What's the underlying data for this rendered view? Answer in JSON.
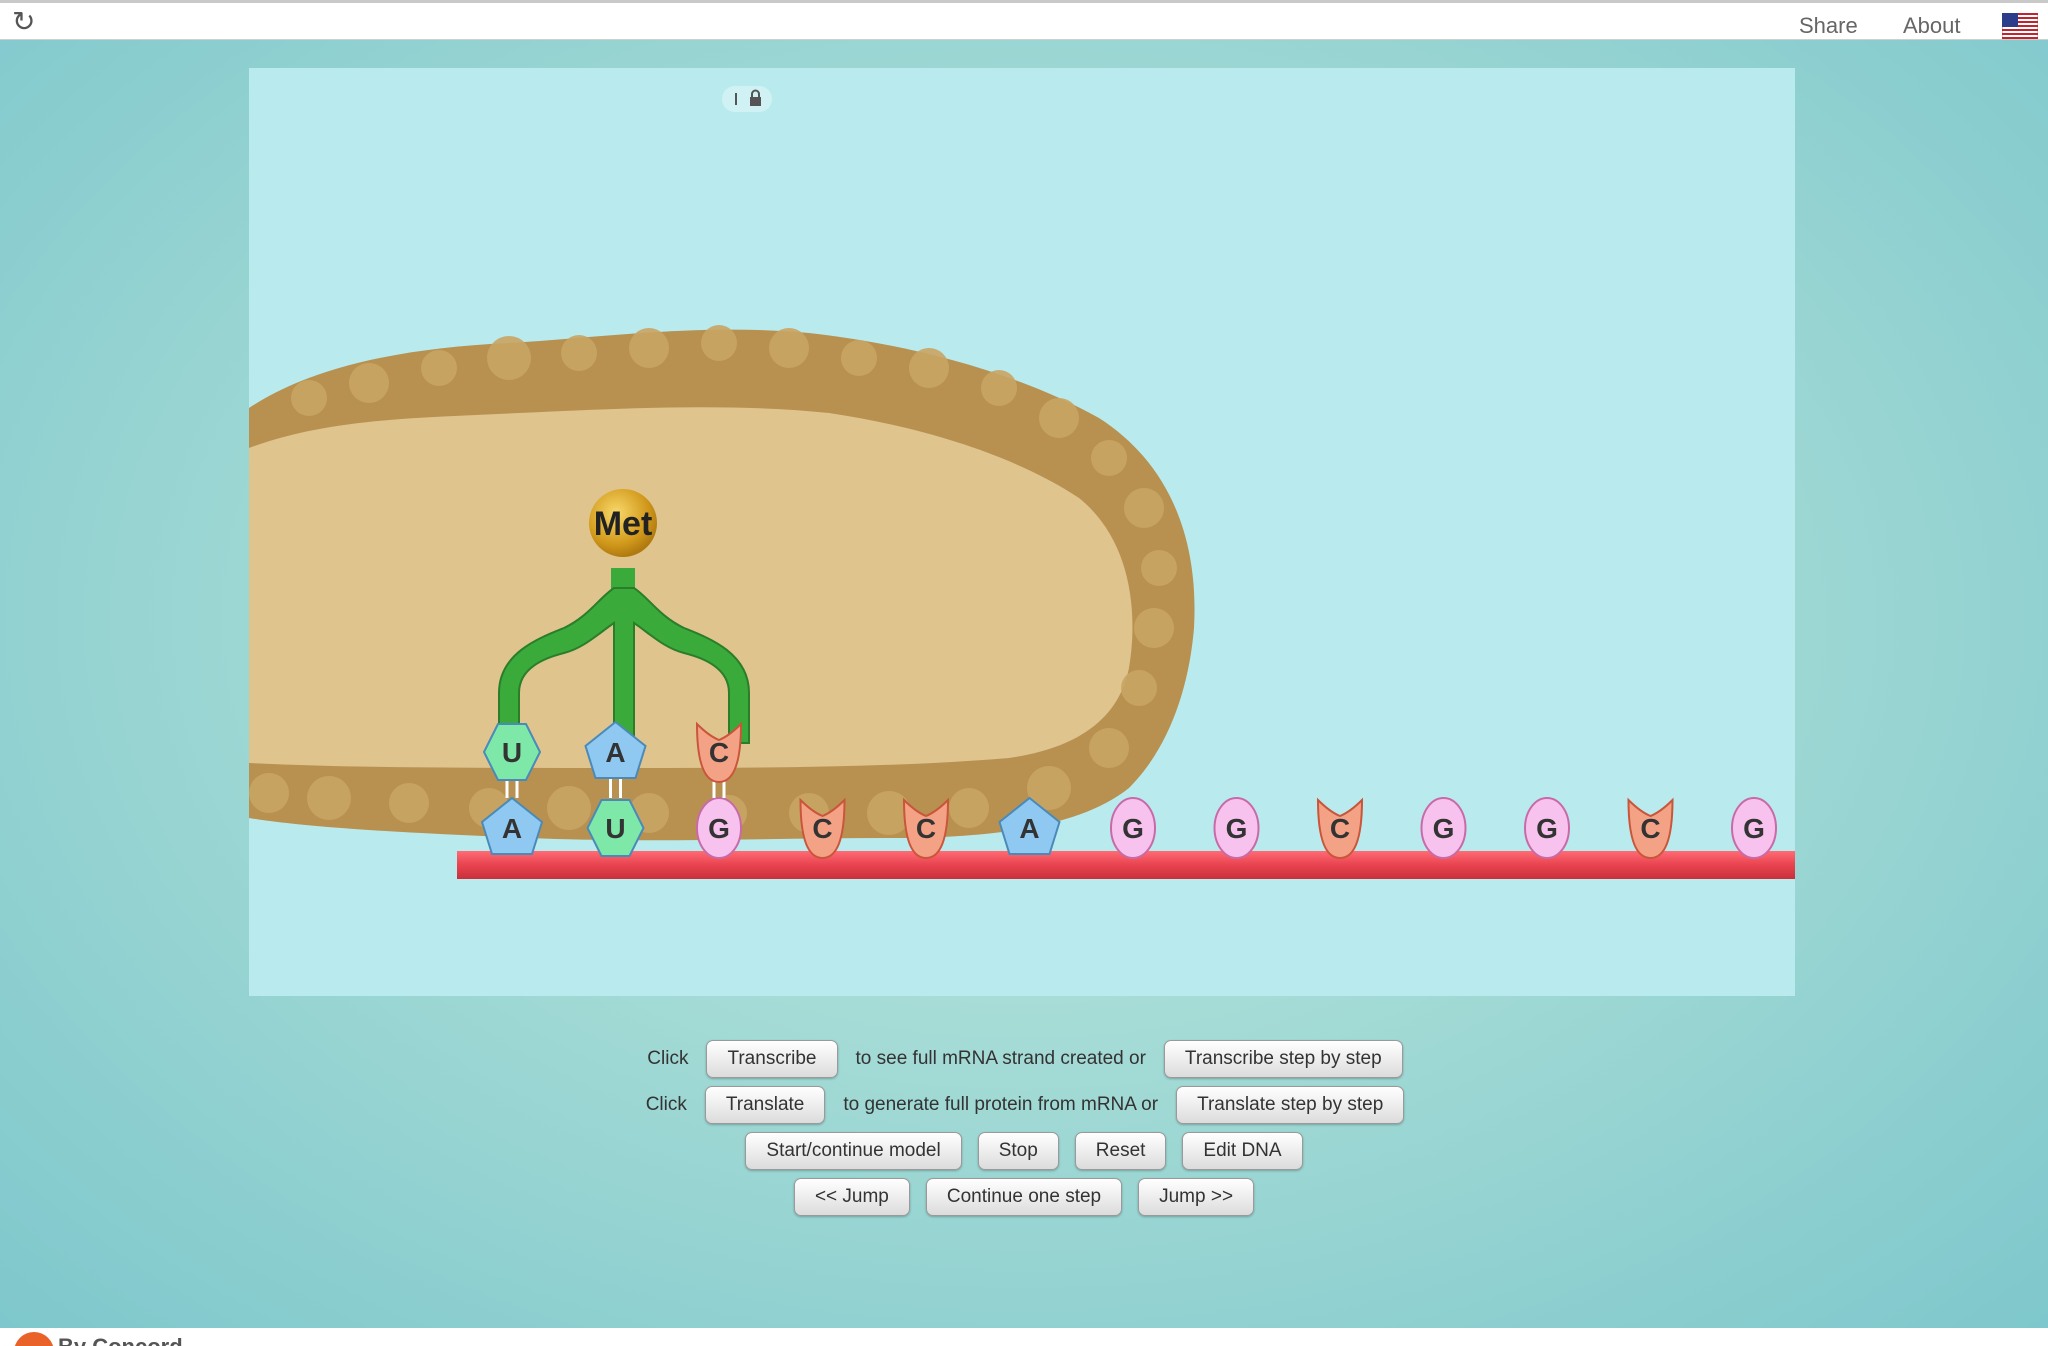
{
  "topbar": {
    "reload_icon": "reload-icon",
    "share_label": "Share",
    "about_label": "About",
    "flag_icon": "us-flag-icon"
  },
  "simulation": {
    "amino_acid": "Met",
    "trna_anticodon": [
      "U",
      "A",
      "C"
    ],
    "mrna_bases": [
      "A",
      "U",
      "G",
      "C",
      "C",
      "A",
      "G",
      "G",
      "C",
      "G",
      "G",
      "C",
      "G"
    ],
    "colors": {
      "A": "#8fc8f0",
      "U": "#7ee8a8",
      "G": "#f7c2ee",
      "C": "#f4a286",
      "mrna_strand": "#e8434f",
      "trna": "#3aaa3a"
    }
  },
  "controls": {
    "row1": {
      "click": "Click",
      "transcribe": "Transcribe",
      "middle": "to see full mRNA strand created or",
      "transcribe_step": "Transcribe step by step"
    },
    "row2": {
      "click": "Click",
      "translate": "Translate",
      "middle": "to generate full protein from mRNA or",
      "translate_step": "Translate step by step"
    },
    "row3": {
      "start": "Start/continue model",
      "stop": "Stop",
      "reset": "Reset",
      "edit": "Edit DNA"
    },
    "row4": {
      "jump_back": "<< Jump",
      "continue": "Continue one step",
      "jump_fwd": "Jump >>"
    }
  },
  "footer": {
    "brand": "By Concord"
  }
}
